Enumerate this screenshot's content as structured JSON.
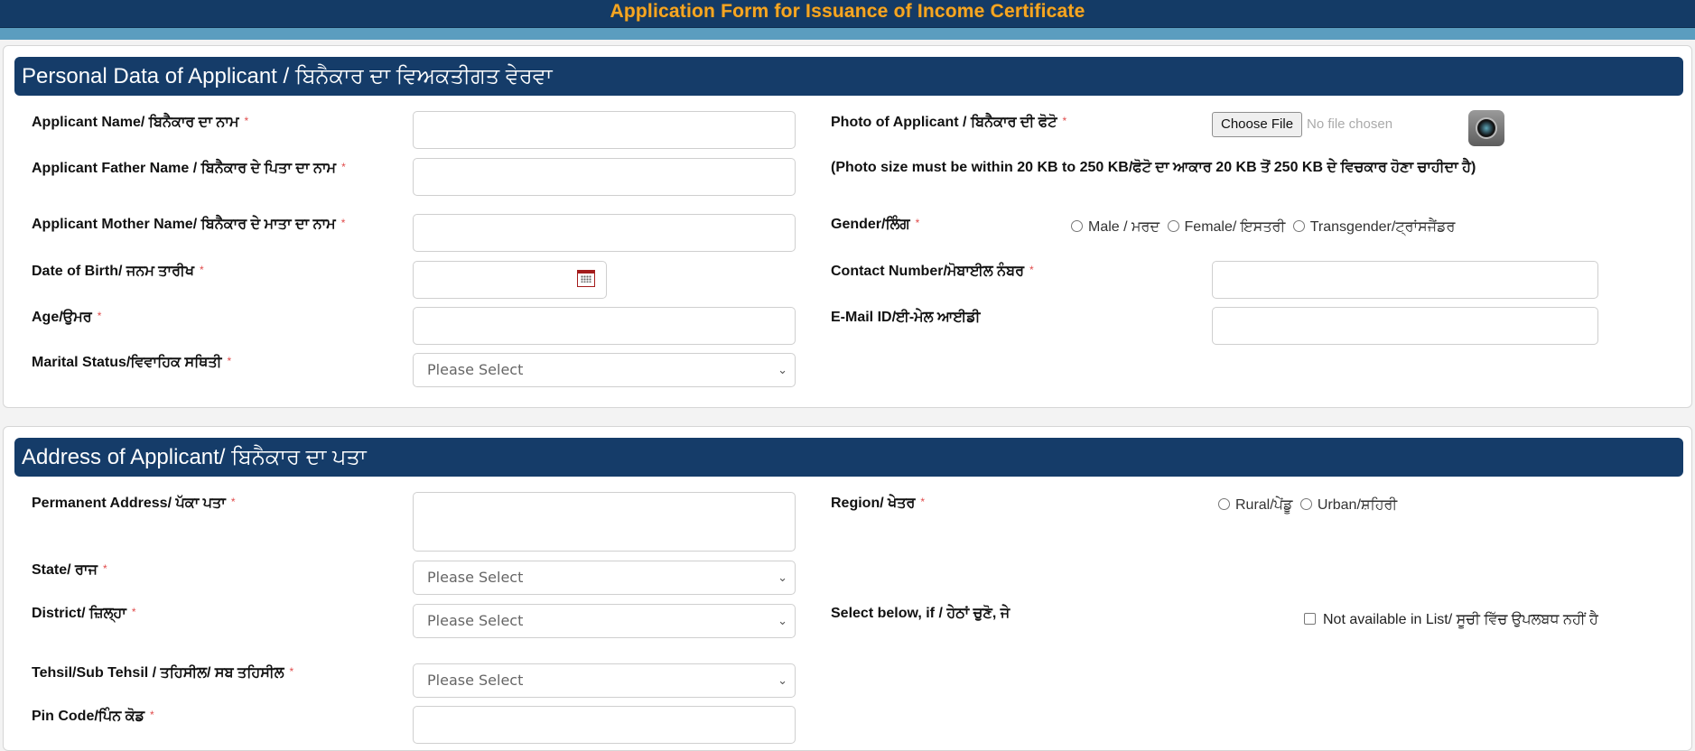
{
  "page": {
    "title": "Application Form for Issuance of Income Certificate",
    "colors": {
      "header_bg": "#143b66",
      "title_text": "#f5a623",
      "band": "#5b9dbf",
      "section_bg": "#153c69",
      "required": "#e04b4b"
    }
  },
  "personal": {
    "heading": "Personal Data of Applicant / ਬਿਨੈਕਾਰ ਦਾ ਵਿਅਕਤੀਗਤ ਵੇਰਵਾ",
    "required_mark": "*",
    "applicant_name": {
      "label": "Applicant Name/ ਬਿਨੈਕਾਰ ਦਾ ਨਾਮ",
      "value": ""
    },
    "father_name": {
      "label": "Applicant Father Name / ਬਿਨੈਕਾਰ ਦੇ ਪਿਤਾ ਦਾ ਨਾਮ",
      "value": ""
    },
    "mother_name": {
      "label": "Applicant Mother Name/ ਬਿਨੈਕਾਰ ਦੇ ਮਾਤਾ ਦਾ ਨਾਮ",
      "value": ""
    },
    "dob": {
      "label": "Date of Birth/ ਜਨਮ ਤਾਰੀਖ",
      "value": "",
      "icon": "calendar-icon"
    },
    "age": {
      "label": "Age/ਉਮਰ",
      "value": ""
    },
    "marital_status": {
      "label": "Marital Status/ਵਿਵਾਹਿਕ ਸਥਿਤੀ",
      "selected": "Please Select"
    },
    "photo": {
      "label": "Photo of Applicant / ਬਿਨੈਕਾਰ ਦੀ ਫੋਟੋ",
      "button": "Choose File",
      "status": "No file chosen",
      "icon": "camera-icon",
      "note": "(Photo size must be within 20 KB to 250 KB/ਫੋਟੋ ਦਾ ਆਕਾਰ 20 KB ਤੋਂ 250 KB ਦੇ ਵਿਚਕਾਰ ਹੋਣਾ ਚਾਹੀਦਾ ਹੈ)"
    },
    "gender": {
      "label": "Gender/ਲਿੰਗ",
      "options": [
        "Male / ਮਰਦ",
        "Female/ ਇਸਤਰੀ",
        "Transgender/ਟ੍ਰਾਂਸਜੈਂਡਰ"
      ]
    },
    "contact": {
      "label": "Contact Number/ਮੋਬਾਈਲ ਨੰਬਰ",
      "value": ""
    },
    "email": {
      "label": "E-Mail ID/ਈ-ਮੇਲ ਆਈਡੀ",
      "value": ""
    }
  },
  "address": {
    "heading": "Address of Applicant/ ਬਿਨੈਕਾਰ ਦਾ ਪਤਾ",
    "permanent": {
      "label": "Permanent Address/ ਪੱਕਾ ਪਤਾ",
      "value": ""
    },
    "state": {
      "label": "State/ ਰਾਜ",
      "selected": "Please Select"
    },
    "district": {
      "label": "District/ ਜ਼ਿਲ੍ਹਾ",
      "selected": "Please Select"
    },
    "tehsil": {
      "label": "Tehsil/Sub Tehsil / ਤਹਿਸੀਲ/ ਸਬ ਤਹਿਸੀਲ",
      "selected": "Please Select"
    },
    "pincode": {
      "label": "Pin Code/ਪਿੰਨ ਕੋਡ",
      "value": ""
    },
    "region": {
      "label": "Region/ ਖੇਤਰ",
      "options": [
        "Rural/ਪੇਂਡੂ",
        "Urban/ਸ਼ਹਿਰੀ"
      ]
    },
    "select_below": {
      "label": "Select below, if / ਹੇਠਾਂ ਚੁਣੋ, ਜੇ",
      "checkbox_label": "Not available in List/ ਸੂਚੀ ਵਿੱਚ ਉਪਲਬਧ ਨਹੀਂ ਹੈ"
    }
  }
}
